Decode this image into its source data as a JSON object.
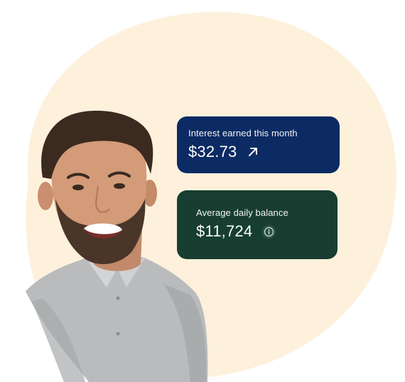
{
  "colors": {
    "background": "#ffffff",
    "blob": "#fdf1dc",
    "interest_card": "#0c2a63",
    "balance_card": "#173e30",
    "card_text": "#ffffff"
  },
  "cards": {
    "interest": {
      "label": "Interest earned this month",
      "value": "$32.73",
      "icon": "arrow-up-right-icon"
    },
    "balance": {
      "label": "Average daily balance",
      "value": "$11,724",
      "icon": "info-icon"
    }
  },
  "illustration": {
    "subject": "smiling-man-photo"
  }
}
